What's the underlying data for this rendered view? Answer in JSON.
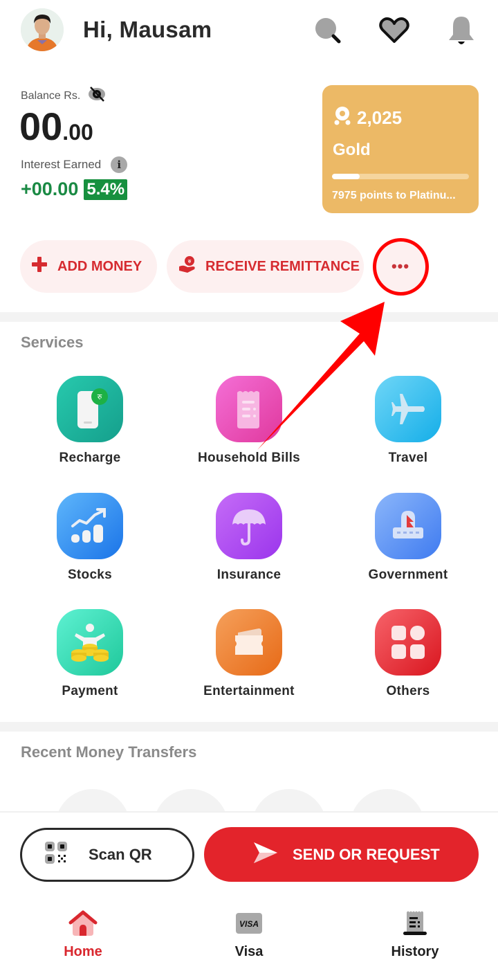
{
  "header": {
    "greeting": "Hi, Mausam",
    "icons": [
      "search-icon",
      "favorites-heart-icon",
      "notification-bell-icon"
    ]
  },
  "balance": {
    "label": "Balance Rs.",
    "amount_major": "00",
    "amount_minor": ".00",
    "visibility_icon": "eye-hidden-icon",
    "interest_label": "Interest Earned",
    "interest_value": "+00.00",
    "interest_rate": "5.4%"
  },
  "rewards": {
    "points": "2,025",
    "tier": "Gold",
    "progress_fraction": 0.2,
    "next_tier_text": "7975 points to Platinu..."
  },
  "actions": {
    "add_money": "ADD MONEY",
    "receive_remittance": "RECEIVE REMITTANCE",
    "more": "•••"
  },
  "services": {
    "title": "Services",
    "items": [
      {
        "label": "Recharge",
        "icon": "recharge-phone-icon"
      },
      {
        "label": "Household Bills",
        "icon": "bill-receipt-icon"
      },
      {
        "label": "Travel",
        "icon": "airplane-icon"
      },
      {
        "label": "Stocks",
        "icon": "stocks-chart-icon"
      },
      {
        "label": "Insurance",
        "icon": "umbrella-icon"
      },
      {
        "label": "Government",
        "icon": "government-building-icon"
      },
      {
        "label": "Payment",
        "icon": "coins-icon"
      },
      {
        "label": "Entertainment",
        "icon": "ticket-icon"
      },
      {
        "label": "Others",
        "icon": "grid-icon"
      }
    ]
  },
  "recent": {
    "title": "Recent Money Transfers"
  },
  "bottom": {
    "scan_qr": "Scan QR",
    "send_request": "SEND OR REQUEST",
    "nav": [
      {
        "label": "Home",
        "active": true
      },
      {
        "label": "Visa",
        "active": false,
        "badge_text": "VISA"
      },
      {
        "label": "History",
        "active": false
      }
    ]
  },
  "colors": {
    "brand_red": "#e3242b",
    "gold_card": "#ecb966",
    "interest_green": "#17903f",
    "annotation_red": "#ff0000"
  }
}
